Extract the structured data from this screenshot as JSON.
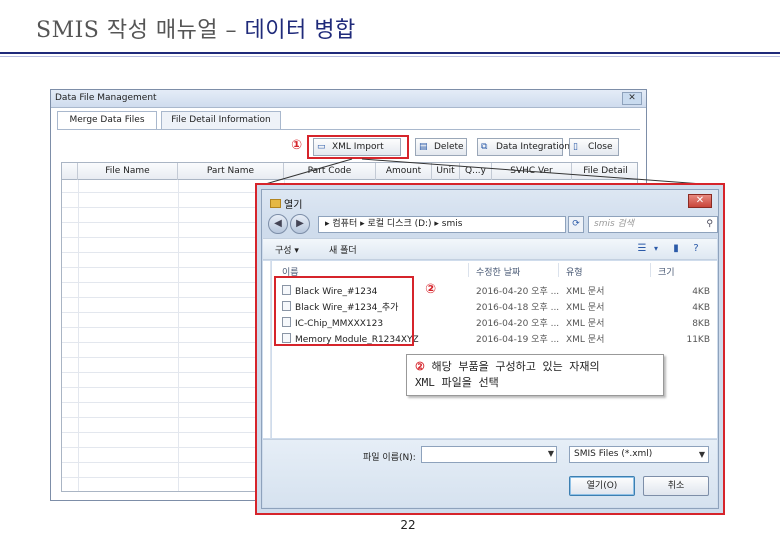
{
  "slide": {
    "title_prefix": "SMIS 작성 매뉴얼 – ",
    "title_accent": "데이터 병합",
    "page_number": "22"
  },
  "back_window": {
    "title": "Data File Management",
    "close_label": "✕",
    "tabs": [
      {
        "label": "Merge Data Files",
        "active": true
      },
      {
        "label": "File Detail Information",
        "active": false
      }
    ],
    "toolbar": {
      "marker": "①",
      "xml_import": "XML Import",
      "delete": "Delete",
      "data_integration": "Data Integration",
      "close": "Close"
    },
    "columns": [
      "File Name",
      "Part Name",
      "Part Code",
      "Amount",
      "Unit",
      "Q...y",
      "SVHC Ver",
      "File Detail"
    ]
  },
  "open_dialog": {
    "title": "열기",
    "close_label": "✕",
    "address_path": "▸ 컴퓨터 ▸ 로컬 디스크 (D:) ▸ smis",
    "search_placeholder": "smis 검색",
    "organize": "구성 ▾",
    "new_folder": "새 폴더",
    "headers": {
      "name": "이름",
      "modified": "수정한 날짜",
      "type": "유형",
      "size": "크기"
    },
    "files_marker": "②",
    "files": [
      {
        "name": "Black Wire_#1234",
        "modified": "2016-04-20 오후 ...",
        "type": "XML 문서",
        "size": "4KB"
      },
      {
        "name": "Black Wire_#1234_추가",
        "modified": "2016-04-18 오후 ...",
        "type": "XML 문서",
        "size": "4KB"
      },
      {
        "name": "IC-Chip_MMXXX123",
        "modified": "2016-04-20 오후 ...",
        "type": "XML 문서",
        "size": "8KB"
      },
      {
        "name": "Memory Module_R1234XYZ",
        "modified": "2016-04-19 오후 ...",
        "type": "XML 문서",
        "size": "11KB"
      }
    ],
    "callout": {
      "number": "②",
      "line1": " 해당 부품을 구성하고 있는 자재의",
      "line2": "XML 파일을 선택"
    },
    "filename_label": "파일 이름(N):",
    "filename_value": "",
    "filetype_value": "SMIS Files (*.xml)",
    "open_button": "열기(O)",
    "cancel_button": "취소"
  },
  "colors": {
    "accent_navy": "#1f2a7a",
    "highlight_red": "#d6242b"
  }
}
